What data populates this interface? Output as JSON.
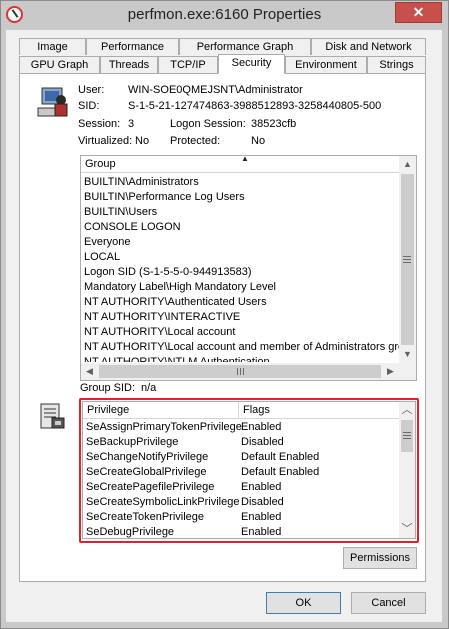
{
  "window": {
    "title": "perfmon.exe:6160 Properties",
    "close_glyph": "✕"
  },
  "tabs_row1": [
    {
      "label": "Image"
    },
    {
      "label": "Performance"
    },
    {
      "label": "Performance Graph"
    },
    {
      "label": "Disk and Network"
    }
  ],
  "tabs_row2": [
    {
      "label": "GPU Graph"
    },
    {
      "label": "Threads"
    },
    {
      "label": "TCP/IP"
    },
    {
      "label": "Security",
      "active": true
    },
    {
      "label": "Environment"
    },
    {
      "label": "Strings"
    }
  ],
  "security": {
    "user_label": "User:",
    "user_value": "WIN-SOE0QMEJSNT\\Administrator",
    "sid_label": "SID:",
    "sid_value": "S-1-5-21-127474863-3988512893-3258440805-500",
    "session_label": "Session:",
    "session_value": "3",
    "logon_session_label": "Logon Session:",
    "logon_session_value": "38523cfb",
    "virtualized_label": "Virtualized:",
    "virtualized_value": "No",
    "protected_label": "Protected:",
    "protected_value": "No",
    "group_sid_label": "Group SID:",
    "group_sid_value": "n/a"
  },
  "groups": {
    "header": "Group",
    "sort_glyph": "▲",
    "items": [
      "BUILTIN\\Administrators",
      "BUILTIN\\Performance Log Users",
      "BUILTIN\\Users",
      "CONSOLE LOGON",
      "Everyone",
      "LOCAL",
      "Logon SID (S-1-5-5-0-944913583)",
      "Mandatory Label\\High Mandatory Level",
      "NT AUTHORITY\\Authenticated Users",
      "NT AUTHORITY\\INTERACTIVE",
      "NT AUTHORITY\\Local account",
      "NT AUTHORITY\\Local account and member of Administrators group",
      "NT AUTHORITY\\NTLM Authentication"
    ]
  },
  "privileges": {
    "col_privilege": "Privilege",
    "col_flags": "Flags",
    "items": [
      {
        "name": "SeAssignPrimaryTokenPrivilege",
        "flags": "Enabled"
      },
      {
        "name": "SeBackupPrivilege",
        "flags": "Disabled"
      },
      {
        "name": "SeChangeNotifyPrivilege",
        "flags": "Default Enabled"
      },
      {
        "name": "SeCreateGlobalPrivilege",
        "flags": "Default Enabled"
      },
      {
        "name": "SeCreatePagefilePrivilege",
        "flags": "Enabled"
      },
      {
        "name": "SeCreateSymbolicLinkPrivilege",
        "flags": "Disabled"
      },
      {
        "name": "SeCreateTokenPrivilege",
        "flags": "Enabled"
      },
      {
        "name": "SeDebugPrivilege",
        "flags": "Enabled"
      }
    ]
  },
  "buttons": {
    "permissions": "Permissions",
    "ok": "OK",
    "cancel": "Cancel"
  },
  "glyphs": {
    "up": "▲",
    "down": "▼",
    "left": "◀",
    "right": "▶",
    "chev_up": "︿",
    "chev_down": "﹀"
  }
}
